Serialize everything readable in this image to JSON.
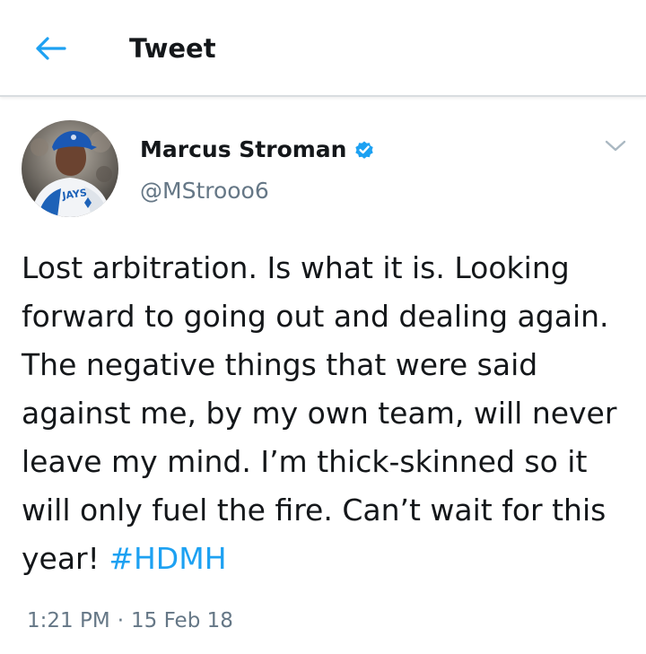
{
  "header": {
    "title": "Tweet",
    "back_icon": "back-arrow-icon",
    "accent_color": "#1da1f2"
  },
  "tweet": {
    "author": {
      "display_name": "Marcus Stroman",
      "handle": "@MStrooo6",
      "verified": true,
      "avatar_jersey_text": "JAYS"
    },
    "text": "Lost arbitration. Is what it is. Looking forward to going out and dealing again. The negative things that were said against me, by my own team, will never leave my mind. I’m thick-skinned so it will only fuel the fire. Can’t wait for this year! ",
    "hashtag": "#HDMH",
    "time": "1:21 PM",
    "separator": "·",
    "date": "15 Feb 18"
  },
  "icons": {
    "verified": "verified-badge-icon",
    "more": "chevron-down-icon"
  }
}
